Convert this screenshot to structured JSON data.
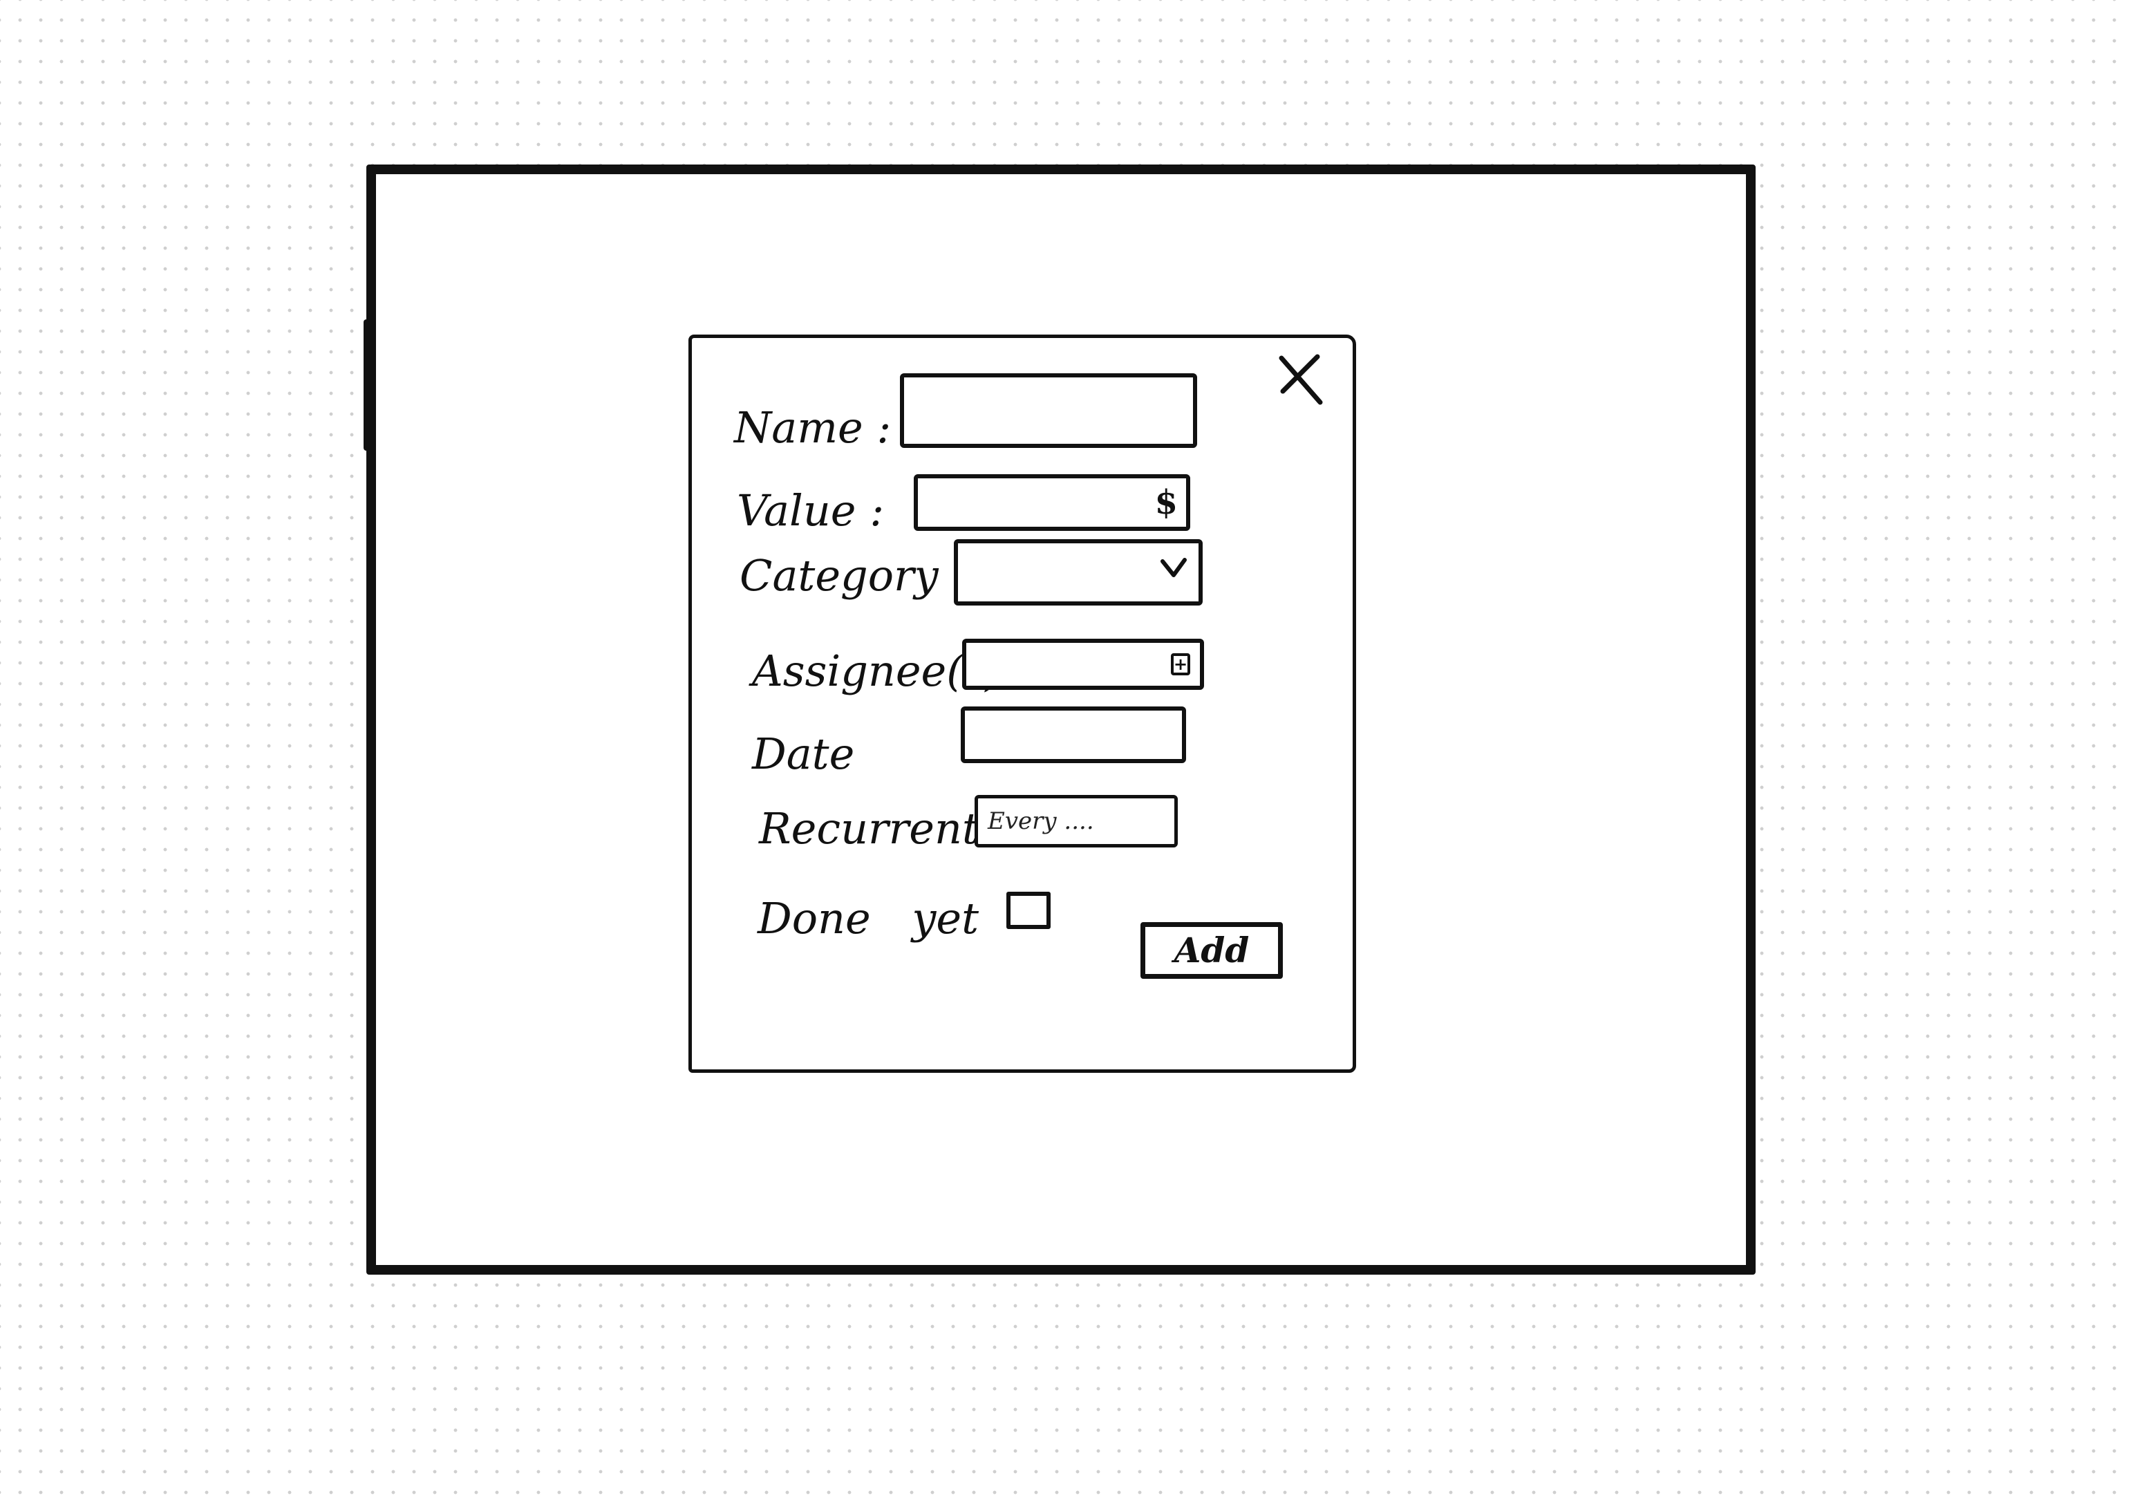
{
  "dialog": {
    "close_icon": "close-icon",
    "fields": {
      "name": {
        "label": "Name :",
        "value": ""
      },
      "value": {
        "label": "Value :",
        "value": "",
        "suffix": "$"
      },
      "category": {
        "label": "Category :",
        "selected": "",
        "dropdown_icon": "chevron-down-icon"
      },
      "assignees": {
        "label": "Assignee(s)",
        "value": "",
        "add_icon": "+"
      },
      "date": {
        "label": "Date",
        "value": ""
      },
      "recurrent": {
        "label": "Recurrent",
        "placeholder": "Every ...."
      },
      "done_yet": {
        "label": "Done yet",
        "checked": false
      }
    },
    "add_button_label": "Add"
  }
}
